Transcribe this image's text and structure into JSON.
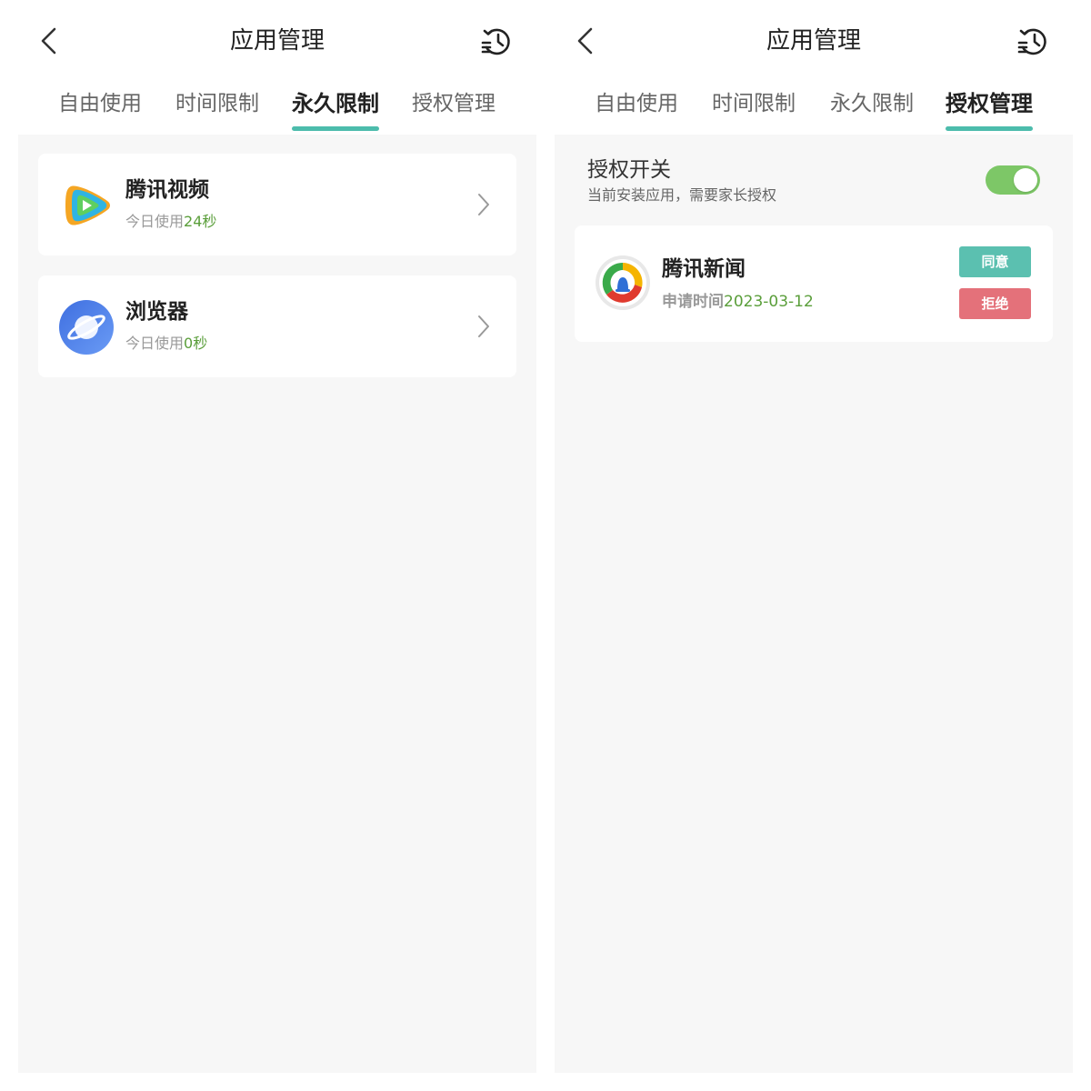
{
  "colors": {
    "accent": "#4cbcac",
    "toggle_on": "#7dc767",
    "agree": "#5bc0b0",
    "reject": "#e4717a",
    "usage_value": "#5a9e3a",
    "content_background": "#f7f7f7"
  },
  "icons": {
    "back": "chevron-left-icon",
    "history": "history-clock-icon",
    "chevron": "chevron-right-icon"
  },
  "left_screen": {
    "title": "应用管理",
    "tabs": [
      {
        "label": "自由使用",
        "active": false
      },
      {
        "label": "时间限制",
        "active": false
      },
      {
        "label": "永久限制",
        "active": true
      },
      {
        "label": "授权管理",
        "active": false
      }
    ],
    "apps": [
      {
        "name": "腾讯视频",
        "usage_label": "今日使用",
        "usage_value": "24秒",
        "icon": "tencent-video-icon"
      },
      {
        "name": "浏览器",
        "usage_label": "今日使用",
        "usage_value": "0秒",
        "icon": "browser-planet-icon"
      }
    ]
  },
  "right_screen": {
    "title": "应用管理",
    "tabs": [
      {
        "label": "自由使用",
        "active": false
      },
      {
        "label": "时间限制",
        "active": false
      },
      {
        "label": "永久限制",
        "active": false
      },
      {
        "label": "授权管理",
        "active": true
      }
    ],
    "auth_switch": {
      "title": "授权开关",
      "description": "当前安装应用，需要家长授权",
      "enabled": true
    },
    "requests": [
      {
        "name": "腾讯新闻",
        "time_label": "申请时间",
        "time_value": "2023-03-12",
        "icon": "tencent-news-icon",
        "agree_label": "同意",
        "reject_label": "拒绝"
      }
    ]
  }
}
